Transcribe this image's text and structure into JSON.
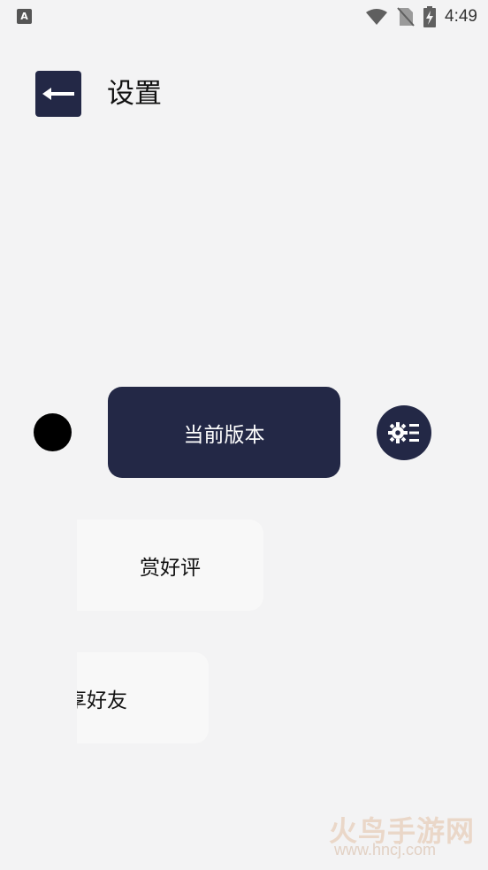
{
  "status_bar": {
    "app_icon_letter": "A",
    "time": "4:49",
    "icons": [
      "wifi-icon",
      "no-sim-icon",
      "battery-charging-icon"
    ]
  },
  "header": {
    "back_icon": "arrow-left-icon",
    "title": "设置"
  },
  "main": {
    "version_button_label": "当前版本",
    "settings_icon": "gear-list-icon",
    "rate_label": "赏好评",
    "share_label": "享好友"
  },
  "watermark": {
    "brand": "火鸟手游网",
    "url": "www.hncj.com"
  },
  "colors": {
    "background": "#f3f3f4",
    "accent": "#232846",
    "card": "#f8f8f8"
  }
}
